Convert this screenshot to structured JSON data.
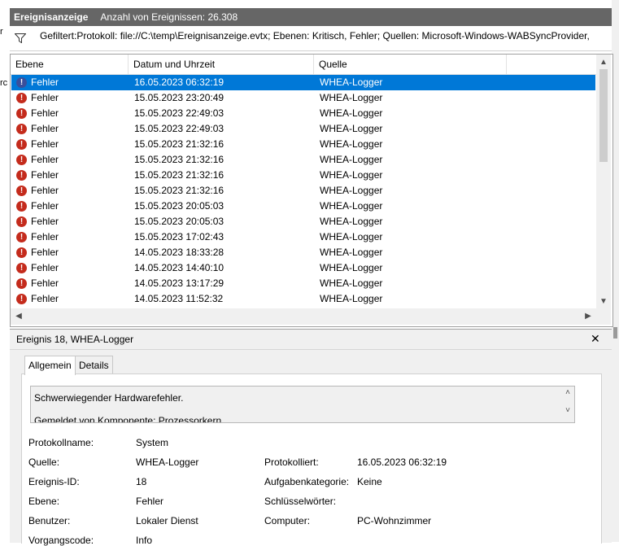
{
  "window": {
    "title": "Ereignisanzeige",
    "event_count": "Anzahl von Ereignissen: 26.308"
  },
  "filter": {
    "text": "Gefiltert:Protokoll: file://C:\\temp\\Ereignisanzeige.evtx; Ebenen: Kritisch, Fehler; Quellen: Microsoft-Windows-WABSyncProvider,"
  },
  "left_gutter": {
    "g1": "r",
    "g2": "rc"
  },
  "grid": {
    "columns": [
      "Ebene",
      "Datum und Uhrzeit",
      "Quelle"
    ],
    "rows": [
      {
        "level": "Fehler",
        "date": "16.05.2023 06:32:19",
        "source": "WHEA-Logger",
        "selected": true
      },
      {
        "level": "Fehler",
        "date": "15.05.2023 23:20:49",
        "source": "WHEA-Logger"
      },
      {
        "level": "Fehler",
        "date": "15.05.2023 22:49:03",
        "source": "WHEA-Logger"
      },
      {
        "level": "Fehler",
        "date": "15.05.2023 22:49:03",
        "source": "WHEA-Logger"
      },
      {
        "level": "Fehler",
        "date": "15.05.2023 21:32:16",
        "source": "WHEA-Logger"
      },
      {
        "level": "Fehler",
        "date": "15.05.2023 21:32:16",
        "source": "WHEA-Logger"
      },
      {
        "level": "Fehler",
        "date": "15.05.2023 21:32:16",
        "source": "WHEA-Logger"
      },
      {
        "level": "Fehler",
        "date": "15.05.2023 21:32:16",
        "source": "WHEA-Logger"
      },
      {
        "level": "Fehler",
        "date": "15.05.2023 20:05:03",
        "source": "WHEA-Logger"
      },
      {
        "level": "Fehler",
        "date": "15.05.2023 20:05:03",
        "source": "WHEA-Logger"
      },
      {
        "level": "Fehler",
        "date": "15.05.2023 17:02:43",
        "source": "WHEA-Logger"
      },
      {
        "level": "Fehler",
        "date": "14.05.2023 18:33:28",
        "source": "WHEA-Logger"
      },
      {
        "level": "Fehler",
        "date": "14.05.2023 14:40:10",
        "source": "WHEA-Logger"
      },
      {
        "level": "Fehler",
        "date": "14.05.2023 13:17:29",
        "source": "WHEA-Logger"
      },
      {
        "level": "Fehler",
        "date": "14.05.2023 11:52:32",
        "source": "WHEA-Logger"
      }
    ]
  },
  "detail": {
    "title": "Ereignis 18, WHEA-Logger",
    "close_glyph": "✕",
    "tabs": [
      "Allgemein",
      "Details"
    ],
    "description_line1": "Schwerwiegender Hardwarefehler.",
    "description_line2": "Gemeldet von Komponente: Prozessorkern",
    "props": {
      "protokollname_label": "Protokollname:",
      "protokollname_value": "System",
      "quelle_label": "Quelle:",
      "quelle_value": "WHEA-Logger",
      "protokolliert_label": "Protokolliert:",
      "protokolliert_value": "16.05.2023 06:32:19",
      "ereignis_id_label": "Ereignis-ID:",
      "ereignis_id_value": "18",
      "aufgabenkategorie_label": "Aufgabenkategorie:",
      "aufgabenkategorie_value": "Keine",
      "ebene_label": "Ebene:",
      "ebene_value": "Fehler",
      "schluesselwoerter_label": "Schlüsselwörter:",
      "benutzer_label": "Benutzer:",
      "benutzer_value": "Lokaler Dienst",
      "computer_label": "Computer:",
      "computer_value": "PC-Wohnzimmer",
      "vorgangscode_label": "Vorgangscode:",
      "vorgangscode_value": "Info"
    }
  },
  "colors": {
    "selection": "#0078d7",
    "titlebar": "#666666",
    "error_icon": "#c42b1c"
  },
  "icons": {
    "row_level": "error-icon",
    "filter": "filter-icon",
    "close": "close-icon"
  }
}
